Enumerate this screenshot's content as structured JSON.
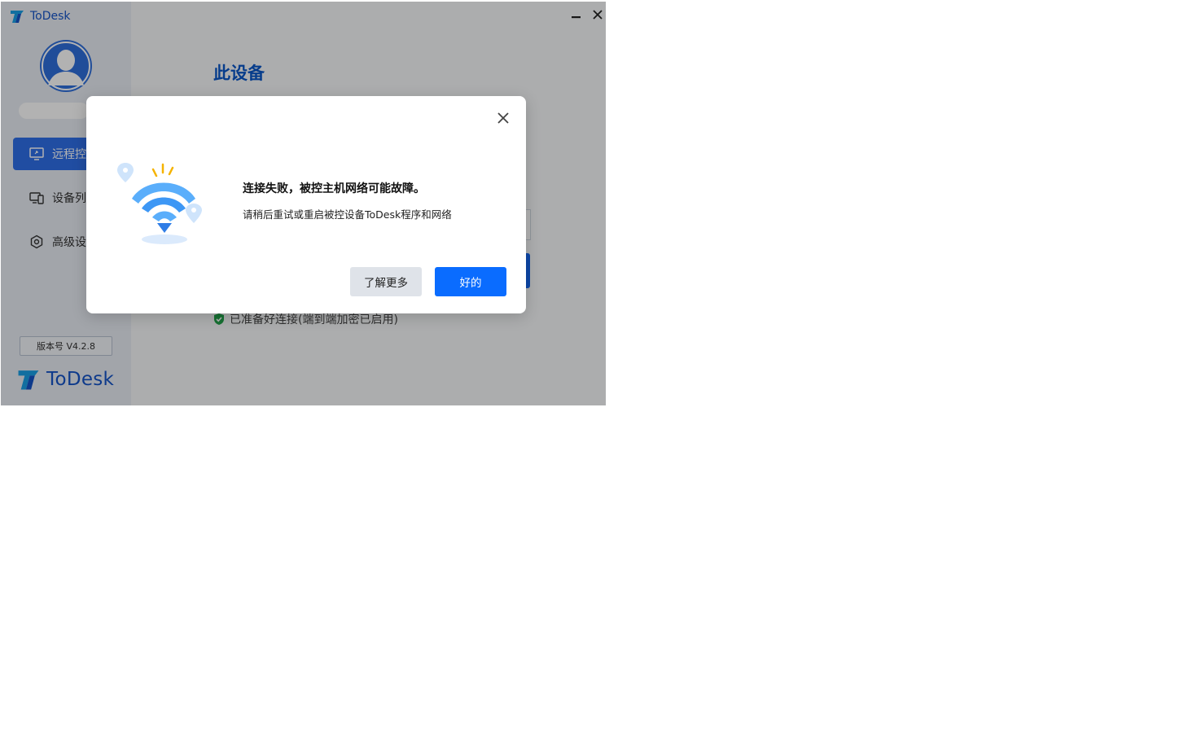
{
  "app": {
    "title": "ToDesk",
    "brand_name": "ToDesk",
    "version_label": "版本号 V4.2.8"
  },
  "sidebar": {
    "items": [
      {
        "label": "远程控",
        "icon": "monitor-icon",
        "active": true
      },
      {
        "label": "设备列",
        "icon": "devices-icon",
        "active": false
      },
      {
        "label": "高级设",
        "icon": "settings-hex-icon",
        "active": false
      }
    ]
  },
  "main": {
    "page_title": "此设备",
    "status_text": "已准备好连接(端到端加密已启用)"
  },
  "dialog": {
    "title": "连接失败，被控主机网络可能故障。",
    "message": "请稍后重试或重启被控设备ToDesk程序和网络",
    "learn_more_label": "了解更多",
    "ok_label": "好的",
    "illustration": "wifi-error-illustration"
  },
  "colors": {
    "accent": "#0a6cff",
    "brand": "#1554c8",
    "status_ok": "#22a34a",
    "overlay": "rgba(0,0,0,0.30)"
  }
}
